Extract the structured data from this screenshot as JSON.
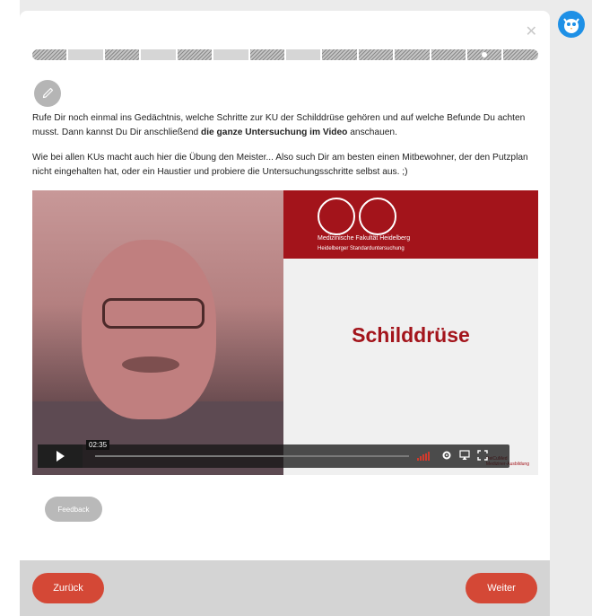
{
  "progress": {
    "segments": [
      {
        "state": "done"
      },
      {
        "state": "todo"
      },
      {
        "state": "done"
      },
      {
        "state": "todo"
      },
      {
        "state": "done"
      },
      {
        "state": "todo"
      },
      {
        "state": "done"
      },
      {
        "state": "todo"
      },
      {
        "state": "done"
      },
      {
        "state": "done"
      },
      {
        "state": "done"
      },
      {
        "state": "done"
      },
      {
        "state": "current"
      },
      {
        "state": "done"
      }
    ]
  },
  "content": {
    "para1_part1": "Rufe Dir noch einmal ins Gedächtnis, welche Schritte zur KU der Schilddrüse gehören und auf welche Befunde Du achten musst. Dann kannst Du Dir anschließend ",
    "para1_bold": "die ganze Untersuchung im Video",
    "para1_part2": " anschauen.",
    "para2": "Wie bei allen KUs macht auch hier die Übung den Meister... Also such Dir am besten einen Mitbewohner, der den Putzplan nicht eingehalten hat, oder ein Haustier und probiere die Untersuchungsschritte selbst aus. ;)"
  },
  "video": {
    "faculty_line1": "Medizinische Fakultät Heidelberg",
    "faculty_line2": "Heidelberger Standarduntersuchung",
    "title": "Schilddrüse",
    "corner_logo_1": "HeiCuMed",
    "corner_logo_2": "Mediziner-Ausbildung",
    "timestamp": "02:35"
  },
  "buttons": {
    "feedback": "Feedback",
    "back": "Zurück",
    "next": "Weiter"
  },
  "colors": {
    "accent": "#d44836",
    "brand_red": "#a3141b",
    "avatar_blue": "#1e90e6"
  },
  "icons": {
    "close": "close-icon",
    "pencil": "pencil-icon",
    "play": "play-icon",
    "settings": "gear-icon",
    "airplay": "airplay-icon",
    "fullscreen": "fullscreen-icon",
    "avatar": "owl-avatar-icon"
  }
}
